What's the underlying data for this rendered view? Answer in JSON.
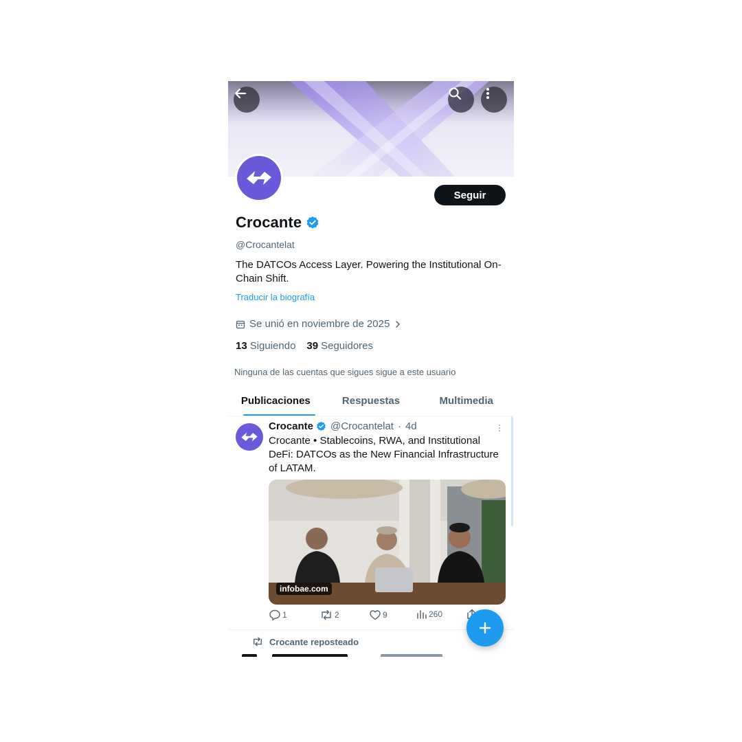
{
  "header": {
    "back_icon": "arrow-left-icon",
    "search_icon": "search-icon",
    "more_icon": "more-vertical-icon"
  },
  "profile": {
    "name": "Crocante",
    "verified": true,
    "handle": "@Crocantelat",
    "bio": "The DATCOs Access Layer. Powering the Institutional On-Chain Shift.",
    "translate_label": "Traducir la biografía",
    "joined": "Se unió en noviembre de 2025",
    "following_count": "13",
    "following_label": "Siguiendo",
    "followers_count": "39",
    "followers_label": "Seguidores",
    "mutuals_note": "Ninguna de las cuentas que sigues sigue a este usuario",
    "follow_button": "Seguir",
    "accent_color": "#1d9bf0",
    "avatar_color": "#6a5ad9"
  },
  "tabs": [
    {
      "label": "Publicaciones",
      "active": true
    },
    {
      "label": "Respuestas",
      "active": false
    },
    {
      "label": "Multimedia",
      "active": false
    }
  ],
  "tweet": {
    "name": "Crocante",
    "handle": "@Crocantelat",
    "time": "4d",
    "separator": "·",
    "text": "Crocante • Stablecoins, RWA, and Institutional DeFi: DATCOs as the New Financial Infrastructure of LATAM.",
    "media_source": "infobae.com",
    "replies": "1",
    "reposts": "2",
    "likes": "9",
    "views": "260"
  },
  "repost_line": {
    "label": "Crocante reposteado"
  },
  "fab": {
    "icon": "plus-icon"
  }
}
